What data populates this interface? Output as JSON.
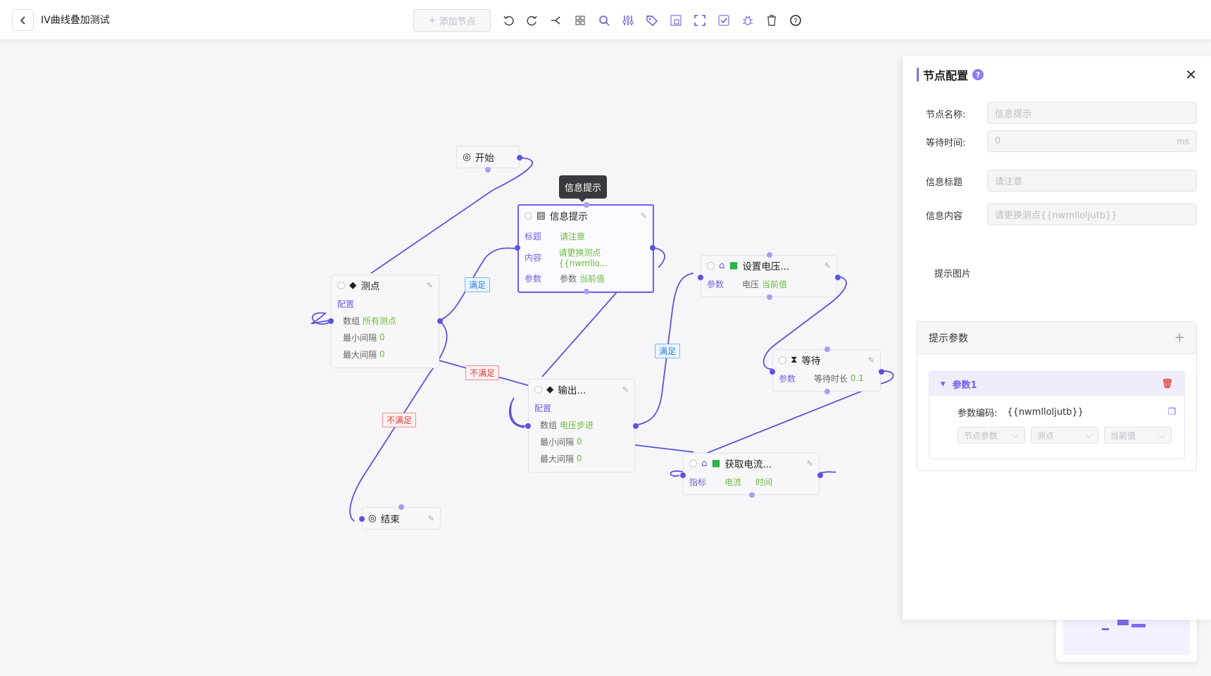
{
  "header": {
    "title": "IV曲线叠加测试",
    "add_node_label": "添加节点"
  },
  "toolbar_icons": [
    "undo-icon",
    "redo-icon",
    "branch-icon",
    "grid-layout-icon",
    "search-icon",
    "sliders-icon",
    "tag-icon",
    "panel-icon",
    "fullscreen-icon",
    "checkbox-icon",
    "debug-icon",
    "delete-icon",
    "help-icon"
  ],
  "nodes": {
    "start": {
      "title": "开始"
    },
    "info": {
      "title": "信息提示",
      "rows": [
        {
          "k": "标题",
          "v": "请注意"
        },
        {
          "k": "内容",
          "v": "请更换测点{{nwmllo..."
        },
        {
          "k": "参数",
          "v1": "参数",
          "v2": "当前值"
        }
      ]
    },
    "points": {
      "title": "测点",
      "config": "配置",
      "rows": [
        {
          "k": "数组",
          "v": "所有测点"
        },
        {
          "k": "最小间隔",
          "v": "0"
        },
        {
          "k": "最大间隔",
          "v": "0"
        }
      ]
    },
    "output": {
      "title": "输出...",
      "config": "配置",
      "rows": [
        {
          "k": "数组",
          "v": "电压步进"
        },
        {
          "k": "最小间隔",
          "v": "0"
        },
        {
          "k": "最大间隔",
          "v": "0"
        }
      ]
    },
    "setvolt": {
      "title": "设置电压...",
      "rows": [
        {
          "k": "参数",
          "v1": "电压",
          "v2": "当前值"
        }
      ]
    },
    "wait": {
      "title": "等待",
      "rows": [
        {
          "k": "参数",
          "v1": "等待时长",
          "v2": "0.1"
        }
      ]
    },
    "getcur": {
      "title": "获取电流...",
      "rows": [
        {
          "k": "指标",
          "v1": "电流",
          "v2": "时间"
        }
      ]
    },
    "end": {
      "title": "结束"
    }
  },
  "edge_labels": {
    "ok1": "满足",
    "ok2": "满足",
    "no1": "不满足",
    "no2": "不满足"
  },
  "tooltip": "信息提示",
  "panel": {
    "title": "节点配置",
    "help": "?",
    "fields": {
      "name": {
        "label": "节点名称:",
        "placeholder": "信息提示"
      },
      "wait": {
        "label": "等待时间:",
        "placeholder": "0",
        "suffix": "ms"
      },
      "msg_title": {
        "label": "信息标题",
        "placeholder": "请注意"
      },
      "msg_content": {
        "label": "信息内容",
        "placeholder": "请更换测点{{nwmlloljutb}}"
      }
    },
    "image_label": "提示图片",
    "params": {
      "title": "提示参数",
      "item": {
        "name": "参数1",
        "code_label": "参数编码:",
        "code_value": "{{nwmlloljutb}}",
        "selects": [
          "节点参数",
          "测点",
          "当前值"
        ]
      }
    }
  }
}
